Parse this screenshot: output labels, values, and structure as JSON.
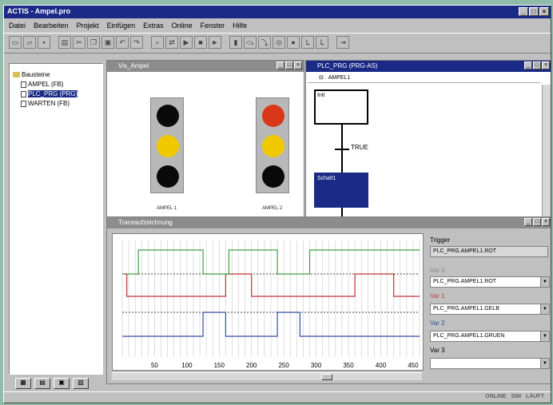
{
  "app": {
    "title": "ACTIS - Ampel.pro",
    "menu": [
      "Datei",
      "Bearbeiten",
      "Projekt",
      "Einfügen",
      "Extras",
      "Online",
      "Fenster",
      "Hilfe"
    ],
    "status": [
      "ONLINE",
      "SIM",
      "LÄUFT"
    ]
  },
  "tree": {
    "root": "Bausteine",
    "items": [
      {
        "label": "AMPEL (FB)",
        "selected": false
      },
      {
        "label": "PLC_PRG (PRG)",
        "selected": true
      },
      {
        "label": "WARTEN (FB)",
        "selected": false
      }
    ]
  },
  "viz_window": {
    "title": "Vis_Ampel",
    "light1": {
      "label": "AMPEL 1",
      "red": "#0a0a0a",
      "yellow": "#f0c800",
      "green": "#0a0a0a"
    },
    "light2": {
      "label": "AMPEL 2",
      "red": "#d83818",
      "yellow": "#f0c800",
      "green": "#0a0a0a"
    }
  },
  "sfc_window": {
    "title": "PLC_PRG (PRG-AS)",
    "path": "⊟ · AMPEL1",
    "init_step": "Init",
    "transition": "TRUE",
    "active_step": "Schalt1"
  },
  "trace_window": {
    "title": "Traceaufzeichnung",
    "trigger_label": "Trigger",
    "trigger_value": "PLC_PRG.AMPEL1.ROT",
    "var0_label": "Var 0",
    "var0": "PLC_PRG.AMPEL1.ROT",
    "var1_label": "Var 1",
    "var1": "PLC_PRG.AMPEL1.GELB",
    "var2_label": "Var 2",
    "var2": "PLC_PRG.AMPEL1.GRUEN",
    "var3_label": "Var 3",
    "var3": ""
  },
  "chart_data": {
    "type": "line",
    "x": [
      0,
      460
    ],
    "xticks": [
      "50",
      "100",
      "150",
      "200",
      "250",
      "300",
      "350",
      "400",
      "450"
    ],
    "series": [
      {
        "color": "#c03030",
        "x": [
          0,
          7,
          7,
          160,
          160,
          200,
          200,
          360,
          360,
          420,
          420,
          460
        ],
        "y": [
          1,
          1,
          0,
          0,
          1,
          1,
          0,
          0,
          1,
          1,
          0,
          0
        ]
      },
      {
        "color": "#3050a0",
        "x": [
          0,
          125,
          125,
          160,
          160,
          240,
          240,
          275,
          275,
          460
        ],
        "y": [
          0,
          0,
          1,
          1,
          0,
          0,
          1,
          1,
          0,
          0
        ]
      },
      {
        "color": "#40a040",
        "x": [
          0,
          25,
          25,
          125,
          125,
          165,
          165,
          240,
          240,
          290,
          290,
          460
        ],
        "y": [
          0,
          0,
          1,
          1,
          0,
          0,
          1,
          1,
          0,
          0,
          1,
          1
        ]
      }
    ]
  }
}
